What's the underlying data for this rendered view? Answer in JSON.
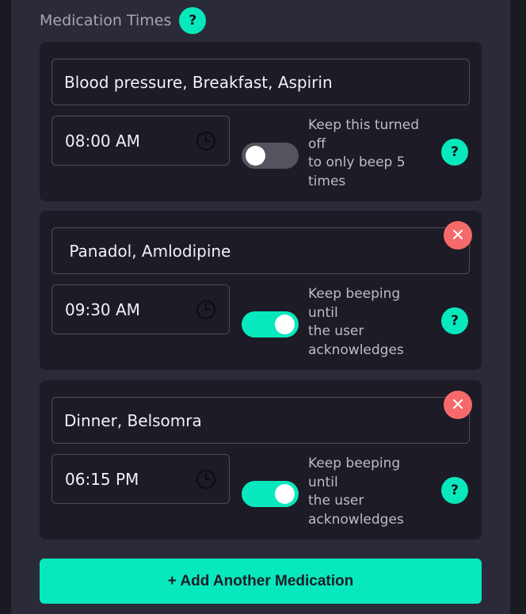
{
  "section": {
    "title": "Medication Times",
    "help_label": "?"
  },
  "medications": [
    {
      "name": "Blood pressure, Breakfast, Aspirin",
      "time": "08:00  AM",
      "beep_until_ack": false,
      "toggle_desc_lines": [
        "Keep this turned",
        "off",
        "to only beep 5",
        "times"
      ],
      "help_label": "?",
      "removable": false
    },
    {
      "name": " Panadol, Amlodipine",
      "time": "09:30  AM",
      "beep_until_ack": true,
      "toggle_desc_lines": [
        "Keep beeping",
        "until",
        "the user",
        "acknowledges"
      ],
      "help_label": "?",
      "removable": true,
      "remove_label": "×"
    },
    {
      "name": "Dinner, Belsomra",
      "time": "06:15  PM",
      "beep_until_ack": true,
      "toggle_desc_lines": [
        "Keep beeping",
        "until",
        "the user",
        "acknowledges"
      ],
      "help_label": "?",
      "removable": true,
      "remove_label": "×"
    }
  ],
  "add_button_label": "+ Add Another Medication",
  "colors": {
    "accent": "#08e8bd",
    "danger": "#f76a6a",
    "card_bg": "#1c1b26",
    "panel_bg": "#2a2a39",
    "toggle_off": "#54545e"
  },
  "icons": {
    "time": "clock-icon",
    "remove": "close-icon"
  }
}
